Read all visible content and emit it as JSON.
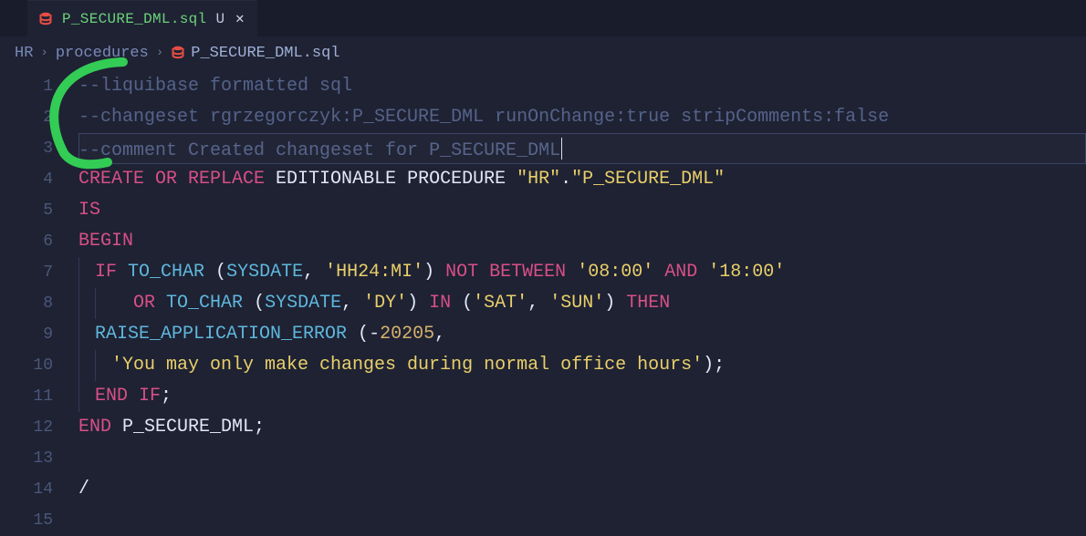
{
  "tab": {
    "title": "P_SECURE_DML.sql",
    "modified_marker": "U",
    "close_glyph": "✕"
  },
  "breadcrumb": {
    "items": [
      "HR",
      "procedures",
      "P_SECURE_DML.sql"
    ],
    "sep": "›"
  },
  "cursor_line": 3,
  "lines": [
    {
      "n": 1,
      "segments": [
        {
          "cls": "c-cmt",
          "t": "--liquibase formatted sql"
        }
      ]
    },
    {
      "n": 2,
      "segments": [
        {
          "cls": "c-cmt",
          "t": "--changeset rgrzegorczyk:P_SECURE_DML runOnChange:true stripComments:false"
        }
      ]
    },
    {
      "n": 3,
      "segments": [
        {
          "cls": "c-cmt",
          "t": "--comment Created changeset for P_SECURE_DML"
        }
      ],
      "caret": true
    },
    {
      "n": 4,
      "segments": [
        {
          "cls": "c-kw",
          "t": "CREATE OR REPLACE"
        },
        {
          "cls": "c-white",
          "t": " EDITIONABLE PROCEDURE "
        },
        {
          "cls": "c-str",
          "t": "\"HR\""
        },
        {
          "cls": "c-white",
          "t": "."
        },
        {
          "cls": "c-str",
          "t": "\"P_SECURE_DML\""
        }
      ]
    },
    {
      "n": 5,
      "segments": [
        {
          "cls": "c-kw",
          "t": "IS"
        }
      ]
    },
    {
      "n": 6,
      "segments": [
        {
          "cls": "c-kw",
          "t": "BEGIN"
        }
      ]
    },
    {
      "n": 7,
      "indent": 1,
      "segments": [
        {
          "cls": "c-kw",
          "t": "IF"
        },
        {
          "cls": "c-white",
          "t": " "
        },
        {
          "cls": "c-fn",
          "t": "TO_CHAR"
        },
        {
          "cls": "c-white",
          "t": " ("
        },
        {
          "cls": "c-fn",
          "t": "SYSDATE"
        },
        {
          "cls": "c-white",
          "t": ", "
        },
        {
          "cls": "c-str",
          "t": "'HH24:MI'"
        },
        {
          "cls": "c-white",
          "t": ") "
        },
        {
          "cls": "c-kw",
          "t": "NOT BETWEEN"
        },
        {
          "cls": "c-white",
          "t": " "
        },
        {
          "cls": "c-str",
          "t": "'08:00'"
        },
        {
          "cls": "c-white",
          "t": " "
        },
        {
          "cls": "c-kw",
          "t": "AND"
        },
        {
          "cls": "c-white",
          "t": " "
        },
        {
          "cls": "c-str",
          "t": "'18:00'"
        }
      ]
    },
    {
      "n": 8,
      "indent": 2,
      "segments": [
        {
          "cls": "c-white",
          "t": "  "
        },
        {
          "cls": "c-kw",
          "t": "OR"
        },
        {
          "cls": "c-white",
          "t": " "
        },
        {
          "cls": "c-fn",
          "t": "TO_CHAR"
        },
        {
          "cls": "c-white",
          "t": " ("
        },
        {
          "cls": "c-fn",
          "t": "SYSDATE"
        },
        {
          "cls": "c-white",
          "t": ", "
        },
        {
          "cls": "c-str",
          "t": "'DY'"
        },
        {
          "cls": "c-white",
          "t": ") "
        },
        {
          "cls": "c-kw",
          "t": "IN"
        },
        {
          "cls": "c-white",
          "t": " ("
        },
        {
          "cls": "c-str",
          "t": "'SAT'"
        },
        {
          "cls": "c-white",
          "t": ", "
        },
        {
          "cls": "c-str",
          "t": "'SUN'"
        },
        {
          "cls": "c-white",
          "t": ") "
        },
        {
          "cls": "c-kw",
          "t": "THEN"
        }
      ]
    },
    {
      "n": 9,
      "indent": 1,
      "segments": [
        {
          "cls": "c-fn",
          "t": "RAISE_APPLICATION_ERROR"
        },
        {
          "cls": "c-white",
          "t": " ("
        },
        {
          "cls": "c-op",
          "t": "-"
        },
        {
          "cls": "c-num",
          "t": "20205"
        },
        {
          "cls": "c-white",
          "t": ","
        }
      ]
    },
    {
      "n": 10,
      "indent": 2,
      "segments": [
        {
          "cls": "c-str",
          "t": "'You may only make changes during normal office hours'"
        },
        {
          "cls": "c-white",
          "t": ");"
        }
      ]
    },
    {
      "n": 11,
      "indent": 1,
      "segments": [
        {
          "cls": "c-kw",
          "t": "END IF"
        },
        {
          "cls": "c-white",
          "t": ";"
        }
      ]
    },
    {
      "n": 12,
      "segments": [
        {
          "cls": "c-kw",
          "t": "END"
        },
        {
          "cls": "c-white",
          "t": " P_SECURE_DML;"
        }
      ]
    },
    {
      "n": 13,
      "segments": []
    },
    {
      "n": 14,
      "segments": [
        {
          "cls": "c-white",
          "t": "/"
        }
      ]
    },
    {
      "n": 15,
      "segments": []
    }
  ]
}
